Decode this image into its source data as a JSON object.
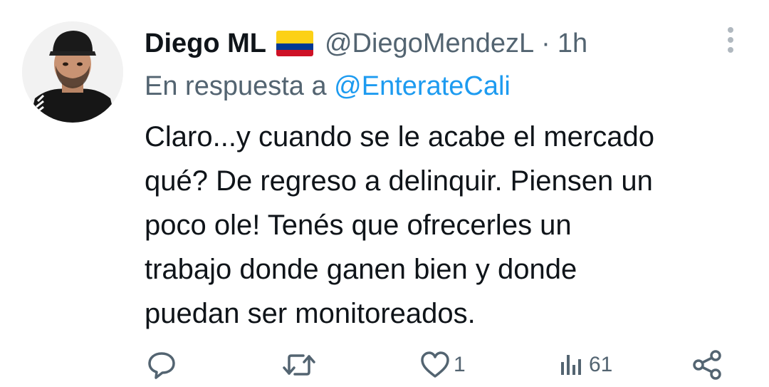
{
  "user": {
    "display_name": "Diego ML",
    "handle": "@DiegoMendezL",
    "separator": "·",
    "time": "1h",
    "flag_icon": "colombia-flag-icon",
    "avatar_icon": "user-avatar"
  },
  "reply": {
    "prefix": "En respuesta a",
    "mention": "@EnterateCali"
  },
  "tweet": {
    "lines": [
      "Claro...y cuando se le acabe el mercado",
      "qué? De regreso a delinquir. Piensen un",
      "poco ole! Tenés que ofrecerles un",
      "trabajo donde ganen bien y donde",
      "puedan ser monitoreados."
    ]
  },
  "actions": {
    "reply_icon": "reply-icon",
    "retweet_icon": "retweet-icon",
    "like_icon": "heart-icon",
    "likes": "1",
    "views_icon": "views-icon",
    "views": "61",
    "share_icon": "share-icon"
  },
  "colors": {
    "text": "#0f1419",
    "secondary": "#536471",
    "link": "#1d9bf0",
    "flag_yellow": "#fcd116",
    "flag_blue": "#003893",
    "flag_red": "#ce1126"
  }
}
